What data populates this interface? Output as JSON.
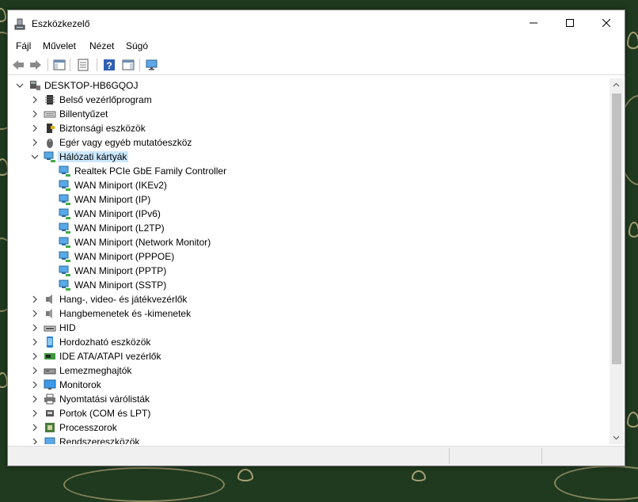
{
  "window": {
    "title": "Eszközkezelő"
  },
  "menu": [
    "Fájl",
    "Művelet",
    "Nézet",
    "Súgó"
  ],
  "toolbar": [
    {
      "icon": "back-arrow-icon"
    },
    {
      "icon": "forward-arrow-icon"
    },
    {
      "icon": "show-hide-console-tree-icon"
    },
    {
      "icon": "properties-icon"
    },
    {
      "icon": "help-icon"
    },
    {
      "icon": "action-pane-icon"
    },
    {
      "icon": "scan-hardware-monitor-icon"
    }
  ],
  "tree": {
    "root": "DESKTOP-HB6GQOJ",
    "categories": [
      {
        "label": "Belső vezérlőprogram",
        "icon": "firmware-chip-icon",
        "expanded": false
      },
      {
        "label": "Billentyűzet",
        "icon": "keyboard-icon",
        "expanded": false
      },
      {
        "label": "Biztonsági eszközök",
        "icon": "security-device-icon",
        "expanded": false
      },
      {
        "label": "Egér vagy egyéb mutatóeszköz",
        "icon": "mouse-icon",
        "expanded": false
      },
      {
        "label": "Hálózati kártyák",
        "icon": "network-adapter-icon",
        "expanded": true,
        "selected": true,
        "children": [
          "Realtek PCIe GbE Family Controller",
          "WAN Miniport (IKEv2)",
          "WAN Miniport (IP)",
          "WAN Miniport (IPv6)",
          "WAN Miniport (L2TP)",
          "WAN Miniport (Network Monitor)",
          "WAN Miniport (PPPOE)",
          "WAN Miniport (PPTP)",
          "WAN Miniport (SSTP)"
        ]
      },
      {
        "label": "Hang-, video- és játékvezérlők",
        "icon": "speaker-icon",
        "expanded": false
      },
      {
        "label": "Hangbemenetek és -kimenetek",
        "icon": "audio-io-icon",
        "expanded": false
      },
      {
        "label": "HID",
        "icon": "hid-icon",
        "expanded": false
      },
      {
        "label": "Hordozható eszközök",
        "icon": "portable-device-icon",
        "expanded": false
      },
      {
        "label": "IDE ATA/ATAPI vezérlők",
        "icon": "ide-controller-icon",
        "expanded": false
      },
      {
        "label": "Lemezmeghajtók",
        "icon": "disk-drive-icon",
        "expanded": false
      },
      {
        "label": "Monitorok",
        "icon": "monitor-icon",
        "expanded": false
      },
      {
        "label": "Nyomtatási várólisták",
        "icon": "printer-icon",
        "expanded": false
      },
      {
        "label": "Portok (COM és LPT)",
        "icon": "port-icon",
        "expanded": false
      },
      {
        "label": "Processzorok",
        "icon": "processor-icon",
        "expanded": false
      },
      {
        "label": "Rendszereszközök",
        "icon": "system-device-icon",
        "expanded": false
      }
    ]
  },
  "colors": {
    "selection": "#cce8ff",
    "network_icon": "#2b8fd6",
    "window_bg": "#ffffff",
    "status_bg": "#f0f0f0"
  }
}
